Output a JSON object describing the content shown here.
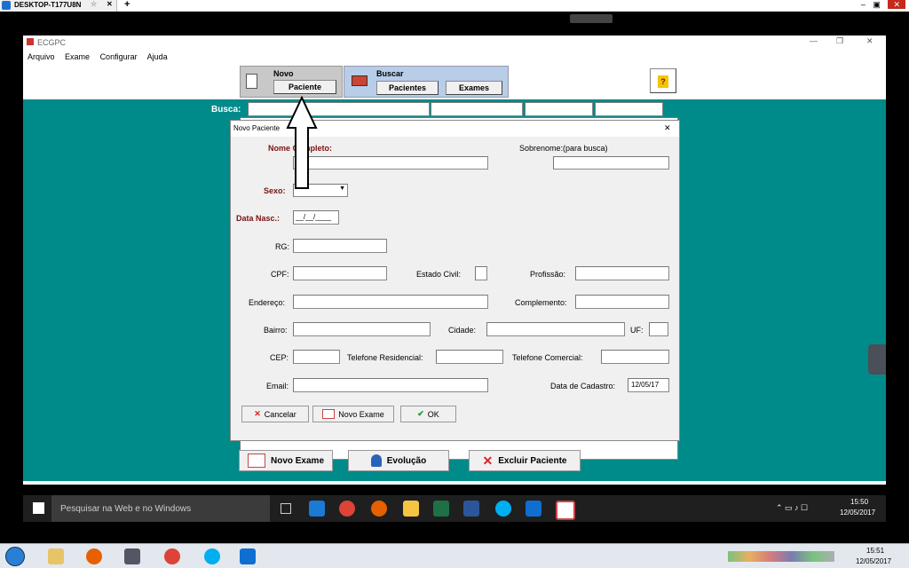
{
  "remote_tab": {
    "title": "DESKTOP-T177U8N"
  },
  "app": {
    "title": "ECGPC",
    "menu": [
      "Arquivo",
      "Exame",
      "Configurar",
      "Ajuda"
    ],
    "toolbar": {
      "novo_label": "Novo",
      "paciente_button": "Paciente",
      "buscar_label": "Buscar",
      "pacientes_button": "Pacientes",
      "exames_button": "Exames",
      "help_button": "?"
    },
    "busca_label": "Busca:",
    "bottom_buttons": {
      "novo_exame": "Novo Exame",
      "evolucao": "Evolução",
      "excluir": "Excluir Paciente"
    }
  },
  "dialog": {
    "title": "Novo Paciente",
    "close": "✕",
    "labels": {
      "nome": "Nome Completo:",
      "sobrenome": "Sobrenome:(para busca)",
      "sexo": "Sexo:",
      "data_nasc": "Data Nasc.:",
      "rg": "RG:",
      "cpf": "CPF:",
      "estado_civil": "Estado Civil:",
      "profissao": "Profissão:",
      "endereco": "Endereço:",
      "complemento": "Complemento:",
      "bairro": "Bairro:",
      "cidade": "Cidade:",
      "uf": "UF:",
      "cep": "CEP:",
      "tel_res": "Telefone Residencial:",
      "tel_com": "Telefone Comercial:",
      "email": "Email:",
      "data_cadastro": "Data de Cadastro:"
    },
    "values": {
      "data_nasc": "__/__/____",
      "data_cadastro": "12/05/17"
    },
    "buttons": {
      "cancelar": "Cancelar",
      "novo_exame": "Novo Exame",
      "ok": "OK"
    }
  },
  "taskbar_inner": {
    "search_placeholder": "Pesquisar na Web e no Windows",
    "time": "15:50",
    "date": "12/05/2017"
  },
  "taskbar_outer": {
    "time": "15:51",
    "date": "12/05/2017"
  },
  "colors": {
    "teal": "#008b8b",
    "required": "#7a1010"
  }
}
